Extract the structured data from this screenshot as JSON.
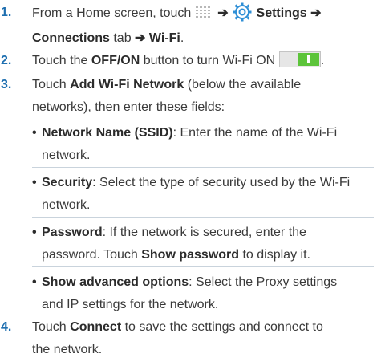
{
  "steps": [
    {
      "number": "1.",
      "from": "From a Home screen, touch",
      "arrow": "➔",
      "settings": "Settings",
      "connections": "Connections",
      "tab": "tab",
      "wifi": "Wi-Fi",
      "period": "."
    },
    {
      "number": "2.",
      "touch": "Touch the",
      "offon": "OFF/ON",
      "rest": "button to turn Wi-Fi ON",
      "period": "."
    },
    {
      "number": "3.",
      "touch": "Touch",
      "add": "Add Wi-Fi Network",
      "rest1": "(below the available",
      "rest2": "networks), then enter these fields:"
    },
    {
      "number": "4.",
      "touch": "Touch",
      "connect": "Connect",
      "rest1": "to save the settings and connect to",
      "rest2": "the network."
    }
  ],
  "fields": [
    {
      "bullet": "•",
      "label": "Network Name (SSID)",
      "line1": ": Enter the name of the Wi-Fi",
      "line2": "network."
    },
    {
      "bullet": "•",
      "label": "Security",
      "line1": ": Select the type of security used by the Wi-Fi",
      "line2": "network."
    },
    {
      "bullet": "•",
      "label": "Password",
      "line1": ": If the network is secured, enter the",
      "line2a": "password. Touch",
      "show": "Show password",
      "line2b": "to display it."
    },
    {
      "bullet": "•",
      "label": "Show advanced options",
      "line1": ": Select the Proxy settings",
      "line2": "and IP settings for the network."
    }
  ],
  "icons": {
    "apps": "apps-grid-icon",
    "settings": "settings-gear-icon",
    "toggle": "toggle-on-icon"
  },
  "colors": {
    "step_number": "#1e6fb0",
    "text": "#3a3a3a",
    "toggle_green": "#5cc43a",
    "gear_blue": "#2f8fd6"
  }
}
